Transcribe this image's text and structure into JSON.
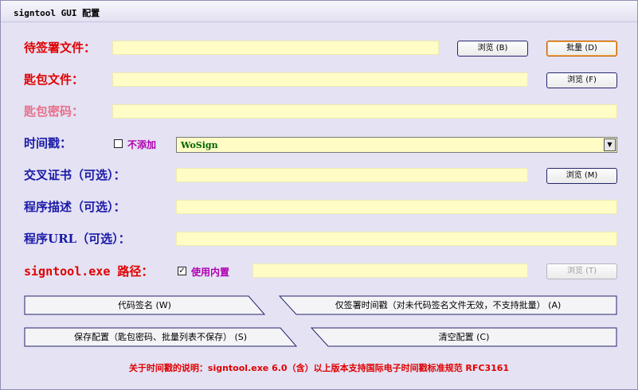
{
  "window": {
    "title": "signtool GUI 配置"
  },
  "rows": {
    "file_to_sign": {
      "label": "待签署文件：",
      "value": "",
      "browse": "浏览 (B)",
      "batch": "批量 (D)"
    },
    "key_file": {
      "label": "匙包文件：",
      "value": "",
      "browse": "浏览 (F)"
    },
    "key_password": {
      "label": "匙包密码：",
      "value": ""
    },
    "timestamp": {
      "label": "时间戳：",
      "no_add_label": "不添加",
      "no_add_checked": false,
      "selected": "WoSign"
    },
    "cross_cert": {
      "label": "交叉证书（可选）：",
      "value": "",
      "browse": "浏览 (M)"
    },
    "description": {
      "label": "程序描述（可选）：",
      "value": ""
    },
    "program_url": {
      "label": "程序URL（可选）：",
      "value": ""
    },
    "signtool_path": {
      "label": "signtool.exe 路径：",
      "use_builtin_label": "使用内置",
      "use_builtin_checked": true,
      "value": "",
      "browse": "浏览 (T)"
    }
  },
  "actions": {
    "sign_code": "代码签名 (W)",
    "timestamp_only": "仅签署时间戳（对未代码签名文件无效，不支持批量） (A)",
    "save_config": "保存配置（匙包密码、批量列表不保存） (S)",
    "clear_config": "清空配置 (C)"
  },
  "note": "关于时间戳的说明：signtool.exe 6.0（含）以上版本支持国际电子时间戳标准规范 RFC3161",
  "colors": {
    "label_red": "#e00000",
    "label_blue": "#1a1aa8",
    "label_pink": "#e8708a",
    "field_bg": "#fffcc6",
    "window_bg": "#e4e2f3"
  }
}
